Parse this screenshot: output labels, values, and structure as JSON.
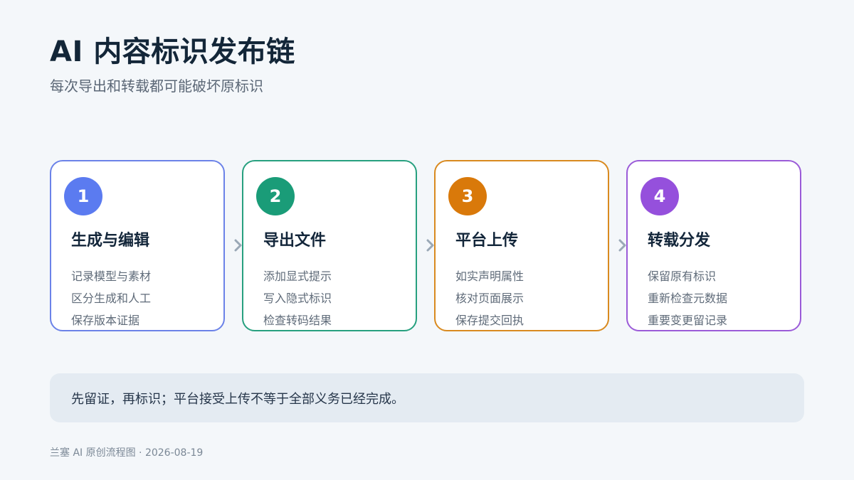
{
  "title": "AI 内容标识发布链",
  "subtitle": "每次导出和转载都可能破坏原标识",
  "steps": [
    {
      "number": "1",
      "title": "生成与编辑",
      "items": [
        "记录模型与素材",
        "区分生成和人工",
        "保存版本证据"
      ],
      "color": "#5b7bf0",
      "border": "#6b82e8"
    },
    {
      "number": "2",
      "title": "导出文件",
      "items": [
        "添加显式提示",
        "写入隐式标识",
        "检查转码结果"
      ],
      "color": "#1a9c78",
      "border": "#27a07f"
    },
    {
      "number": "3",
      "title": "平台上传",
      "items": [
        "如实声明属性",
        "核对页面展示",
        "保存提交回执"
      ],
      "color": "#d9790a",
      "border": "#d98a1f"
    },
    {
      "number": "4",
      "title": "转载分发",
      "items": [
        "保留原有标识",
        "重新检查元数据",
        "重要变更留记录"
      ],
      "color": "#9550dc",
      "border": "#9b5bd8"
    }
  ],
  "note": "先留证，再标识；平台接受上传不等于全部义务已经完成。",
  "footer": "兰塞 AI 原创流程图 · 2026-08-19",
  "colors": {
    "background": "#f4f7fa",
    "arrow": "#9aa8b6",
    "note_bg": "#e4ebf2"
  }
}
